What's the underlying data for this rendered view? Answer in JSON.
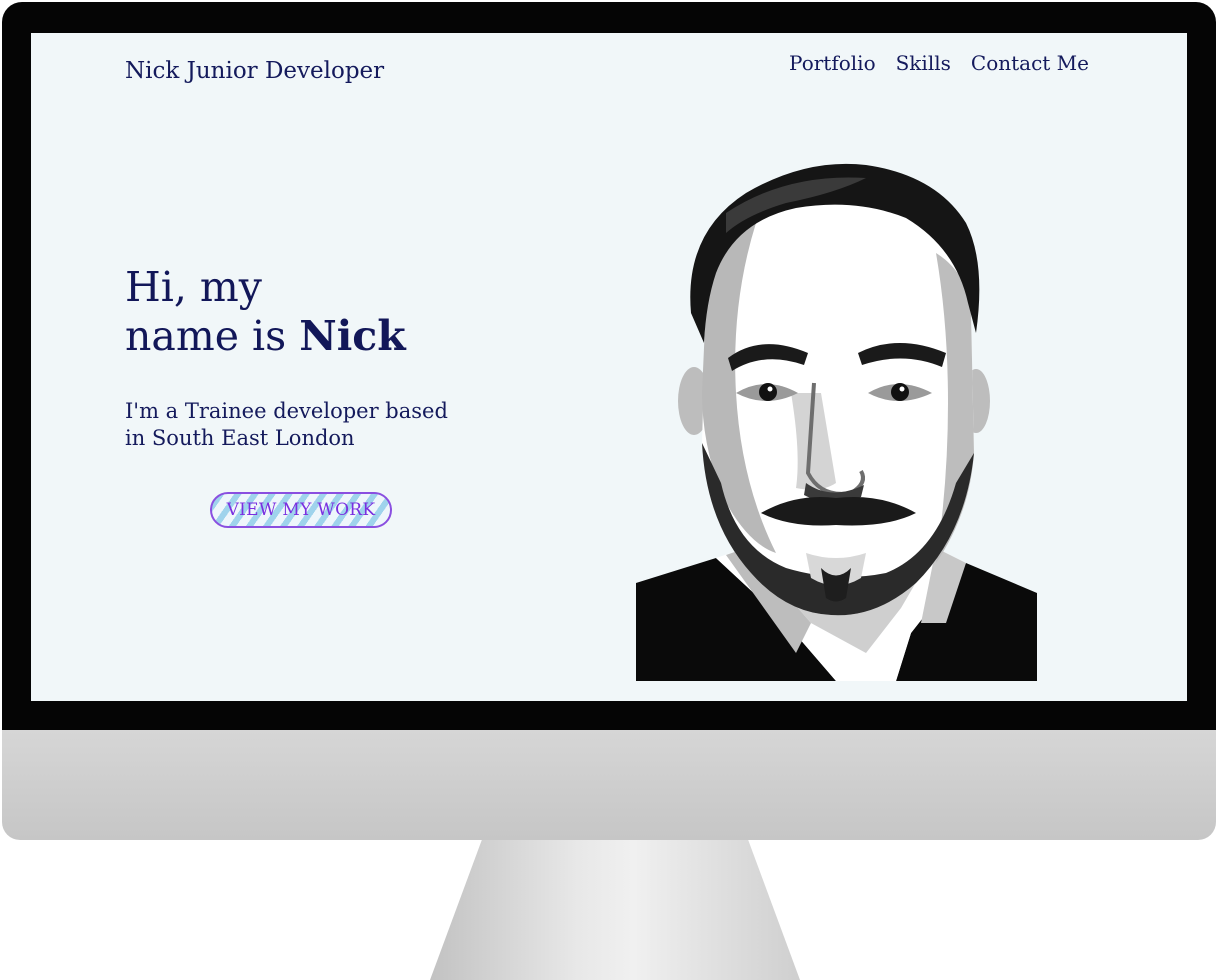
{
  "header": {
    "brand": "Nick Junior Developer",
    "nav": [
      {
        "label": "Portfolio"
      },
      {
        "label": "Skills"
      },
      {
        "label": "Contact Me"
      }
    ]
  },
  "hero": {
    "heading_line1": "Hi, my",
    "heading_line2_prefix": "name is ",
    "heading_name": "Nick",
    "subtitle": "I'm a Trainee developer based in South East London",
    "cta_label": "VIEW MY WORK"
  },
  "colors": {
    "screen_bg": "#f1f7f9",
    "text": "#141a5c",
    "cta_border": "#8a4fe0",
    "cta_text": "#7a2fe0",
    "cta_stripe": "#9fd3ec"
  }
}
